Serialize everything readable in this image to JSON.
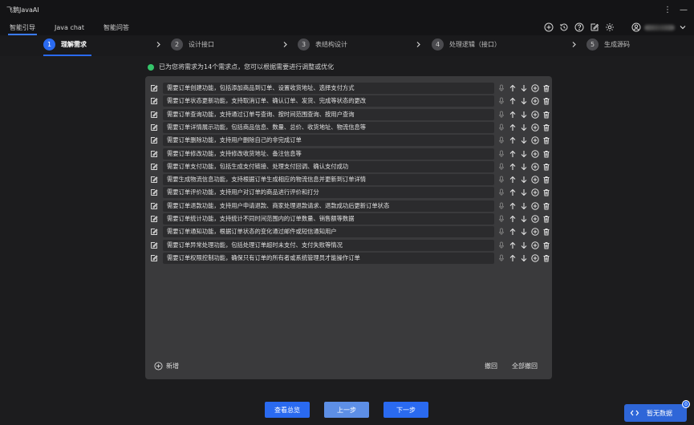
{
  "window": {
    "title": "飞鹅JavaAI",
    "menu_icon": "more-vertical-icon",
    "minimize_icon": "minimize-icon"
  },
  "topnav": {
    "tabs": [
      {
        "label": "智能引导",
        "active": true
      },
      {
        "label": "Java chat",
        "active": false
      },
      {
        "label": "智能问答",
        "active": false
      }
    ],
    "tool_icons": [
      "add-circle-icon",
      "history-icon",
      "help-icon",
      "edit-icon",
      "settings-icon"
    ],
    "user": {
      "avatar_icon": "user-circle-icon",
      "dropdown_icon": "chevron-down-icon"
    }
  },
  "steps": [
    {
      "num": "1",
      "label": "理解需求",
      "active": true
    },
    {
      "num": "2",
      "label": "设计接口",
      "active": false
    },
    {
      "num": "3",
      "label": "表结构设计",
      "active": false
    },
    {
      "num": "4",
      "label": "处理逻辑（接口）",
      "active": false
    },
    {
      "num": "5",
      "label": "生成源码",
      "active": false
    }
  ],
  "notice": {
    "text": "已为您将需求为14个需求点，您可以根据需要进行调整或优化",
    "color": "#35c46a"
  },
  "requirements": [
    "需要订单创建功能，包括添加商品到订单、设置收货地址、选择支付方式",
    "需要订单状态更新功能，支持取消订单、确认订单、发货、完成等状态的更改",
    "需要订单查询功能，支持通过订单号查询、按时间范围查询、按用户查询",
    "需要订单详情展示功能，包括商品信息、数量、总价、收货地址、物流信息等",
    "需要订单删除功能，支持用户删除自己的非完成订单",
    "需要订单修改功能，支持修改收货地址、备注信息等",
    "需要订单支付功能，包括生成支付链接、处理支付回调、确认支付成功",
    "需要生成物流信息功能，支持根据订单生成相应的物流信息并更新到订单详情",
    "需要订单评价功能，支持用户对订单的商品进行评价和打分",
    "需要订单退款功能，支持用户申请退款、商家处理退款请求、退款成功后更新订单状态",
    "需要订单统计功能，支持统计不同时间范围内的订单数量、销售额等数据",
    "需要订单通知功能，根据订单状态的变化通过邮件或短信通知用户",
    "需要订单异常处理功能，包括处理订单超时未支付、支付失败等情况",
    "需要订单权限控制功能，确保只有订单的所有者或系统管理员才能操作订单"
  ],
  "panel": {
    "add_label": "新增",
    "undo_label": "撤回",
    "undo_all_label": "全部撤回"
  },
  "buttons": {
    "summary": "查看总览",
    "prev": "上一步",
    "next": "下一步"
  },
  "floating": {
    "label": "暂无数据",
    "badge": "0",
    "icon": "code-icon"
  },
  "colors": {
    "accent": "#2a6af0",
    "background": "#1c1c1e",
    "panel": "#3a3a3c"
  }
}
